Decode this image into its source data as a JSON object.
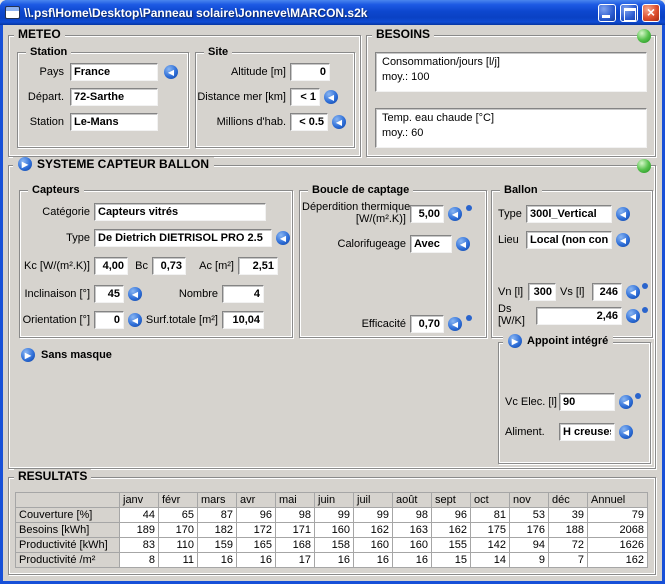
{
  "window": {
    "title": "\\\\.psf\\Home\\Desktop\\Panneau solaire\\Jonneve\\MARCON.s2k"
  },
  "meteo": {
    "title": "METEO",
    "station": {
      "title": "Station",
      "pays_label": "Pays",
      "pays_value": "France",
      "depart_label": "Départ.",
      "depart_value": "72-Sarthe",
      "station_label": "Station",
      "station_value": "Le-Mans"
    },
    "site": {
      "title": "Site",
      "altitude_label": "Altitude [m]",
      "altitude_value": "0",
      "distance_label": "Distance mer [km]",
      "distance_value": "< 1",
      "habitants_label": "Millions d'hab.",
      "habitants_value": "< 0.5"
    }
  },
  "besoins": {
    "title": "BESOINS",
    "consommation_label": "Consommation/jours [l/j]",
    "consommation_value": "moy.: 100",
    "temperature_label": "Temp. eau chaude [°C]",
    "temperature_value": "moy.: 60"
  },
  "systeme": {
    "title": "SYSTEME CAPTEUR BALLON",
    "capteurs": {
      "title": "Capteurs",
      "categorie_label": "Catégorie",
      "categorie_value": "Capteurs vitrés",
      "type_label": "Type",
      "type_value": "De Dietrich DIETRISOL PRO 2.5",
      "kc_label": "Kc [W/(m².K)]",
      "kc_value": "4,00",
      "bc_label": "Bc",
      "bc_value": "0,73",
      "ac_label": "Ac [m²]",
      "ac_value": "2,51",
      "inclinaison_label": "Inclinaison [°]",
      "inclinaison_value": "45",
      "nombre_label": "Nombre",
      "nombre_value": "4",
      "orientation_label": "Orientation [°]",
      "orientation_value": "0",
      "surface_label": "Surf.totale [m²]",
      "surface_value": "10,04"
    },
    "boucle": {
      "title": "Boucle de captage",
      "deperdition_label": "Déperdition thermique",
      "deperdition_unit": "[W/(m².K)]",
      "deperdition_value": "5,00",
      "calorifugeage_label": "Calorifugeage",
      "calorifugeage_value": "Avec",
      "efficacite_label": "Efficacité",
      "efficacite_value": "0,70"
    },
    "ballon": {
      "title": "Ballon",
      "type_label": "Type",
      "type_value": "300l_Vertical",
      "lieu_label": "Lieu",
      "lieu_value": "Local (non contrôlé)",
      "vn_label": "Vn [l]",
      "vn_value": "300",
      "vs_label": "Vs [l]",
      "vs_value": "246",
      "ds_label": "Ds",
      "ds_unit": "[W/K]",
      "ds_value": "2,46"
    },
    "sans_masque_label": "Sans masque",
    "appoint": {
      "title": "Appoint intégré",
      "vc_label": "Vc Elec. [l]",
      "vc_value": "90",
      "aliment_label": "Aliment.",
      "aliment_value": "H creuses"
    }
  },
  "resultats": {
    "title": "RESULTATS",
    "columns": [
      "janv",
      "févr",
      "mars",
      "avr",
      "mai",
      "juin",
      "juil",
      "août",
      "sept",
      "oct",
      "nov",
      "déc",
      "Annuel"
    ],
    "rows": [
      {
        "label": "Couverture [%]",
        "values": [
          "44",
          "65",
          "87",
          "96",
          "98",
          "99",
          "99",
          "98",
          "96",
          "81",
          "53",
          "39",
          "79"
        ]
      },
      {
        "label": "Besoins [kWh]",
        "values": [
          "189",
          "170",
          "182",
          "172",
          "171",
          "160",
          "162",
          "163",
          "162",
          "175",
          "176",
          "188",
          "2068"
        ]
      },
      {
        "label": "Productivité [kWh]",
        "values": [
          "83",
          "110",
          "159",
          "165",
          "168",
          "158",
          "160",
          "160",
          "155",
          "142",
          "94",
          "72",
          "1626"
        ]
      },
      {
        "label": "Productivité /m²",
        "values": [
          "8",
          "11",
          "16",
          "16",
          "17",
          "16",
          "16",
          "16",
          "15",
          "14",
          "9",
          "7",
          "162"
        ]
      }
    ]
  }
}
